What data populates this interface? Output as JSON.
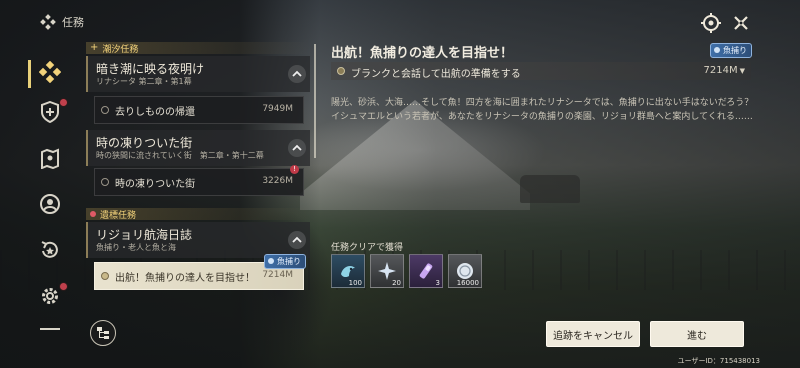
{
  "header": {
    "title": "任務"
  },
  "sidebar": {
    "items": [
      {
        "name": "quests",
        "icon": "diamond-cluster-icon",
        "active": true,
        "badge": false
      },
      {
        "name": "shield",
        "icon": "shield-plus-icon",
        "active": false,
        "badge": true
      },
      {
        "name": "map",
        "icon": "map-pin-icon",
        "active": false,
        "badge": false
      },
      {
        "name": "profile",
        "icon": "person-circle-icon",
        "active": false,
        "badge": false
      },
      {
        "name": "history",
        "icon": "star-return-icon",
        "active": false,
        "badge": false
      },
      {
        "name": "settings",
        "icon": "gear-icon",
        "active": false,
        "badge": true
      }
    ]
  },
  "quest_list": {
    "sections": [
      {
        "label": "潮汐任務",
        "groups": [
          {
            "title": "暗き潮に映る夜明け",
            "subtitle": "リナシータ 第二章・第1幕",
            "tasks": [
              {
                "name": "去りしものの帰還",
                "distance": "7949M",
                "warning": false
              }
            ]
          },
          {
            "title": "時の凍りついた街",
            "subtitle": "時の狭間に流されていく街　第二章・第十二幕",
            "tasks": [
              {
                "name": "時の凍りついた街",
                "distance": "3226M",
                "warning": true
              }
            ]
          }
        ]
      },
      {
        "label": "遺標任務",
        "groups": [
          {
            "title": "リジョリ航海日誌",
            "subtitle": "魚捕り・老人と魚と海",
            "tasks": [
              {
                "name": "出航！魚捕りの達人を目指せ！",
                "distance": "7214M",
                "tag": "魚捕り",
                "selected": true
              }
            ]
          }
        ]
      }
    ]
  },
  "detail": {
    "title": "出航！魚捕りの達人を目指せ！",
    "tag": "魚捕り",
    "objective": "ブランクと会話して出航の準備をする",
    "objective_distance": "7214M",
    "description_line1": "陽光、砂浜、大海……そして魚！四方を海に囲まれたリナシータでは、魚捕りに出ない手はないだろう？",
    "description_line2": "イシュマエルという若者が、あなたをリナシータの魚捕りの楽園、リジョリ群島へと案内してくれる……"
  },
  "rewards": {
    "label": "任務クリアで獲得",
    "items": [
      {
        "icon": "fish-bait-icon",
        "qty": "100",
        "rarity": "blue"
      },
      {
        "icon": "star-shard-icon",
        "qty": "20",
        "rarity": "grey"
      },
      {
        "icon": "crystal-tube-icon",
        "qty": "3",
        "rarity": "purple"
      },
      {
        "icon": "shell-coin-icon",
        "qty": "16000",
        "rarity": "grey"
      }
    ]
  },
  "buttons": {
    "cancel_tracking": "追跡をキャンセル",
    "go": "進む"
  },
  "footer": {
    "user_id": "ユーザーID：715438013"
  },
  "colors": {
    "accent_gold": "#e8d07a",
    "tag_blue": "#3f6fa8",
    "badge_red": "#c0404c",
    "button_bg": "#eee9db"
  }
}
